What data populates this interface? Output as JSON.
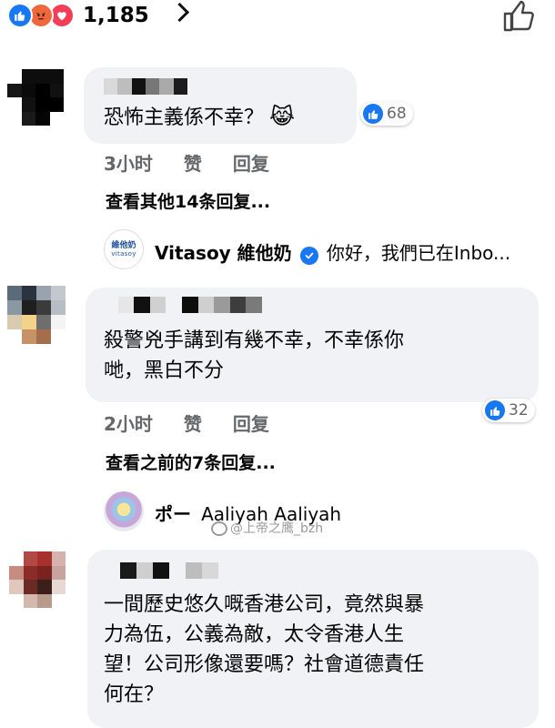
{
  "header": {
    "reactions": [
      "like",
      "angry",
      "love"
    ],
    "reaction_count": "1,185"
  },
  "comments": [
    {
      "text": "恐怖主義係不幸？",
      "emoji": "😹",
      "likes": "68",
      "time": "3小时",
      "like_label": "赞",
      "reply_label": "回复",
      "view_more": "查看其他14条回复...",
      "reply_preview": {
        "avatar_line1": "維他奶",
        "avatar_line2": "vitasoy",
        "name": "Vitasoy 維他奶",
        "text": "你好，我們已在Inbo..."
      }
    },
    {
      "text_lines": [
        "殺警兇手講到有幾不幸，不幸係你",
        "哋，黑白不分"
      ],
      "likes": "32",
      "time": "2小时",
      "like_label": "赞",
      "reply_label": "回复",
      "view_more": "查看之前的7条回复...",
      "reply_preview": {
        "name": "ポー",
        "text": "Aaliyah Aaliyah"
      }
    },
    {
      "text_lines": [
        "一間歷史悠久嘅香港公司，竟然與暴",
        "力為伍，公義為敵，太令香港人生",
        "望！公司形像還要嗎？社會道德責任",
        "何在？"
      ]
    }
  ],
  "watermark": "@上帝之鹰_bzh",
  "colors": {
    "accent": "#1877f2",
    "bubble": "#f0f2f5",
    "meta": "#65676b"
  }
}
